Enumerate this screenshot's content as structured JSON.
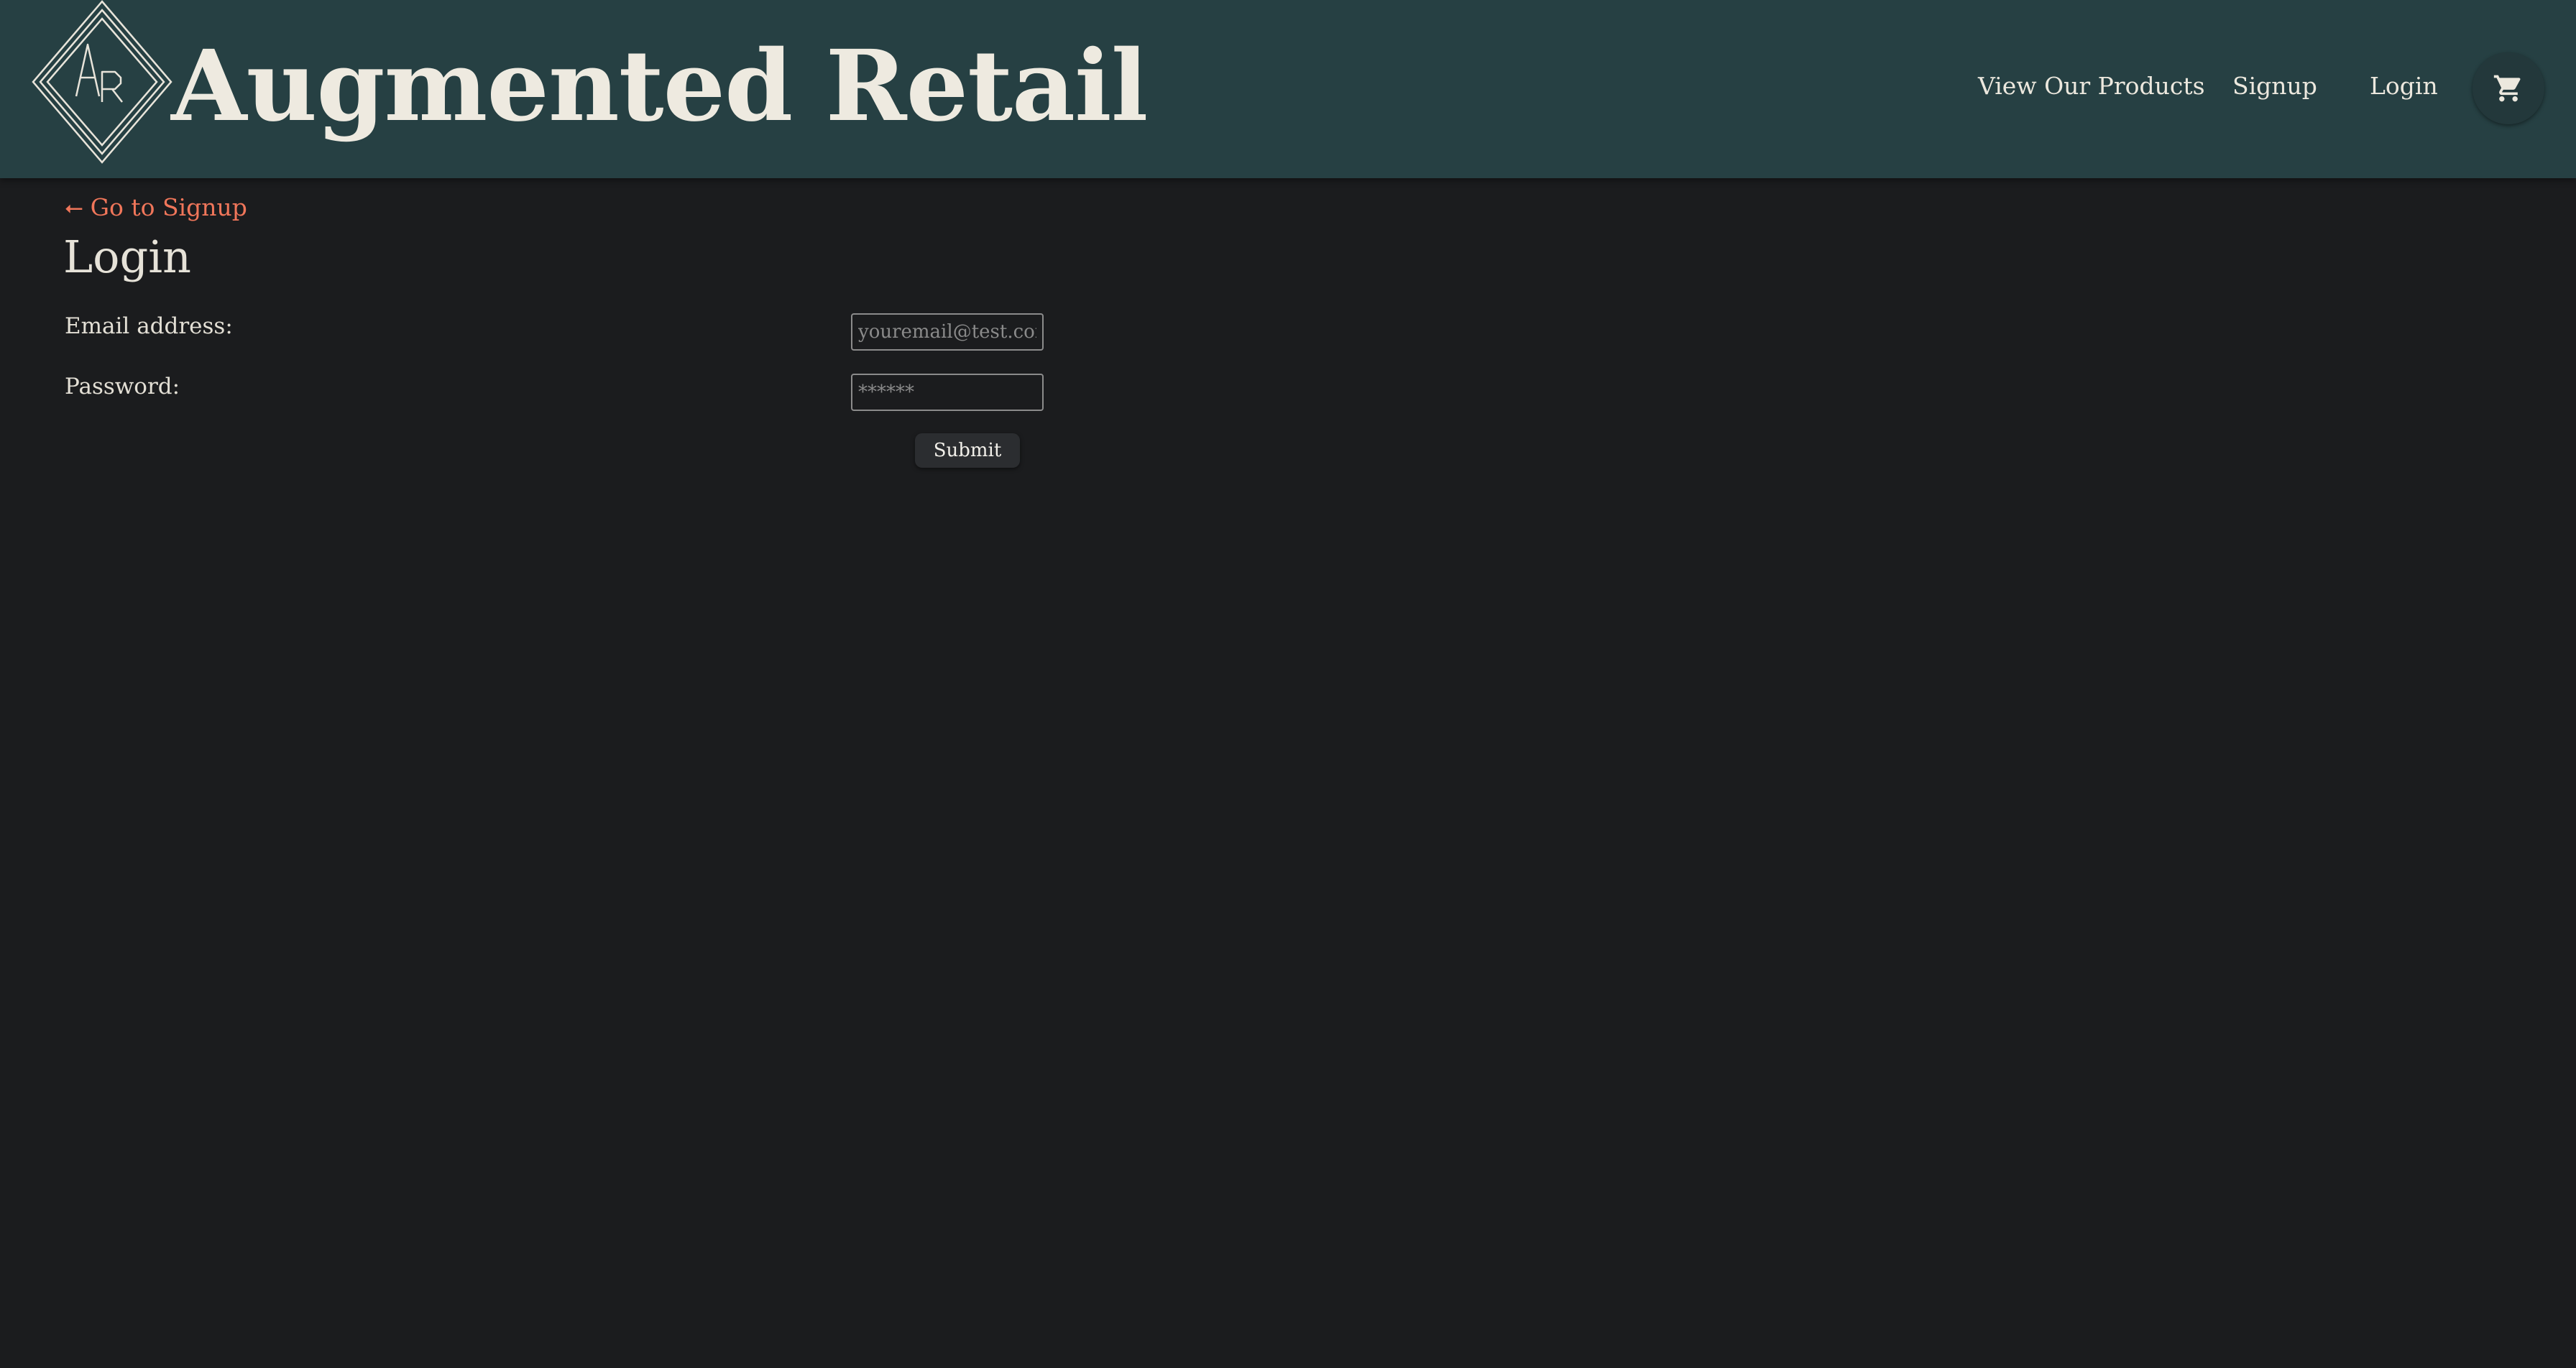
{
  "header": {
    "brand_title": "Augmented Retail",
    "logo_letters": "AR",
    "logo_icon": "ar-diamond-logo-icon",
    "background_color": "#264043",
    "nav": {
      "products_label": "View Our Products",
      "signup_label": "Signup",
      "login_label": "Login",
      "cart_icon": "shopping-cart-icon"
    }
  },
  "main": {
    "back_link": {
      "arrow_icon": "arrow-left-icon",
      "arrow_glyph": "⭠",
      "label": "Go to Signup",
      "color": "#f0765a"
    },
    "title": "Login",
    "form": {
      "email_label": "Email address:",
      "email_placeholder": "youremail@test.com",
      "email_value": "",
      "password_label": "Password:",
      "password_placeholder": "******",
      "password_value": "",
      "submit_label": "Submit"
    }
  },
  "colors": {
    "page_background": "#1b1c1e",
    "header_background": "#264043",
    "accent": "#f0765a",
    "text": "#e6e2d8"
  }
}
